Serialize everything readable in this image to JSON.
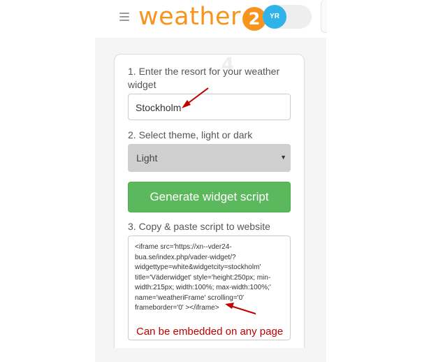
{
  "header": {
    "logo_text": "weather",
    "logo_badge": "2",
    "toggle_label": "YR"
  },
  "card": {
    "step_number": "4",
    "step1_label": "1. Enter the resort for your weather widget",
    "resort_value": "Stockholm",
    "step2_label": "2. Select theme, light or dark",
    "theme_selected": "Light",
    "generate_button": "Generate widget script",
    "step3_label": "3. Copy & paste script to website",
    "script_code": "<iframe src='https://xn--vder24-bua.se/index.php/vader-widget/?widgettype=white&widgetcity=stockholm' title='Väderwidget' style='height:250px; min-width:215px; width:100%; max-width:100%;' name='weatheriFrame' scrolling='0' frameborder='0' ></iframe>",
    "annotation": "Can be embedded on any page"
  },
  "colors": {
    "brand_orange": "#f7941d",
    "toggle_blue": "#2fb3e8",
    "button_green": "#5cb85c",
    "annotation_red": "#c00000"
  }
}
